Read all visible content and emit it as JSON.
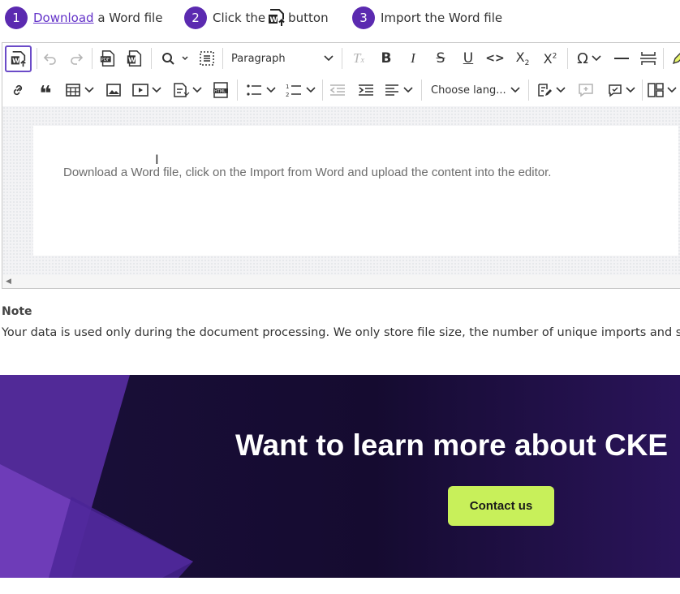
{
  "steps": [
    {
      "num": "1",
      "link": "Download",
      "text": " a Word file"
    },
    {
      "num": "2",
      "before": "Click the",
      "after": "button"
    },
    {
      "num": "3",
      "text": "Import the Word file"
    }
  ],
  "toolbar": {
    "heading_dropdown": "Paragraph",
    "language_dropdown": "Choose lang...",
    "icons_row1": [
      "import-word-icon",
      "undo-icon",
      "redo-icon",
      "export-pdf-icon",
      "export-word-icon",
      "find-replace-icon",
      "select-all-icon",
      "remove-format-icon",
      "bold-icon",
      "italic-icon",
      "strikethrough-icon",
      "underline-icon",
      "code-icon",
      "subscript-icon",
      "superscript-icon",
      "special-characters-icon",
      "horizontal-line-icon",
      "page-break-icon",
      "highlight-icon"
    ],
    "icons_row2": [
      "link-icon",
      "blockquote-icon",
      "table-icon",
      "image-icon",
      "media-icon",
      "template-icon",
      "html-embed-icon",
      "bulleted-list-icon",
      "numbered-list-icon",
      "outdent-icon",
      "indent-icon",
      "alignment-icon",
      "track-changes-icon",
      "comment-icon",
      "comments-archive-icon",
      "layout-icon"
    ]
  },
  "editor": {
    "content": "Download a Word file, click on the Import from Word and upload the content into the editor."
  },
  "note": {
    "title": "Note",
    "text": "Your data is used only during the document processing. We only store file size, the number of unique imports and s"
  },
  "banner": {
    "heading": "Want to learn more about CKE",
    "button": "Contact us"
  },
  "colors": {
    "step_badge": "#5b2ab0",
    "link": "#6433c9",
    "banner_bg": "#170c33",
    "cta": "#c8f05a"
  }
}
